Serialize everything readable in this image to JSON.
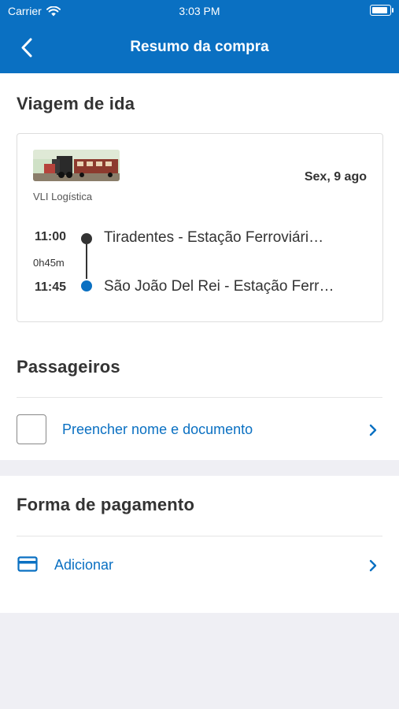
{
  "status_bar": {
    "carrier": "Carrier",
    "time": "3:03 PM"
  },
  "header": {
    "title": "Resumo da compra"
  },
  "trip": {
    "section_title": "Viagem de ida",
    "company": "VLI Logística",
    "date": "Sex, 9 ago",
    "departure_time": "11:00",
    "duration": "0h45m",
    "arrival_time": "11:45",
    "origin": "Tiradentes - Estação Ferroviári…",
    "destination": "São João Del Rei - Estação Ferr…"
  },
  "passengers": {
    "section_title": "Passageiros",
    "fill_label": "Preencher nome e documento"
  },
  "payment": {
    "section_title": "Forma de pagamento",
    "add_label": "Adicionar"
  },
  "colors": {
    "brand": "#0a70c2",
    "background": "#efeff4",
    "text": "#333333"
  }
}
